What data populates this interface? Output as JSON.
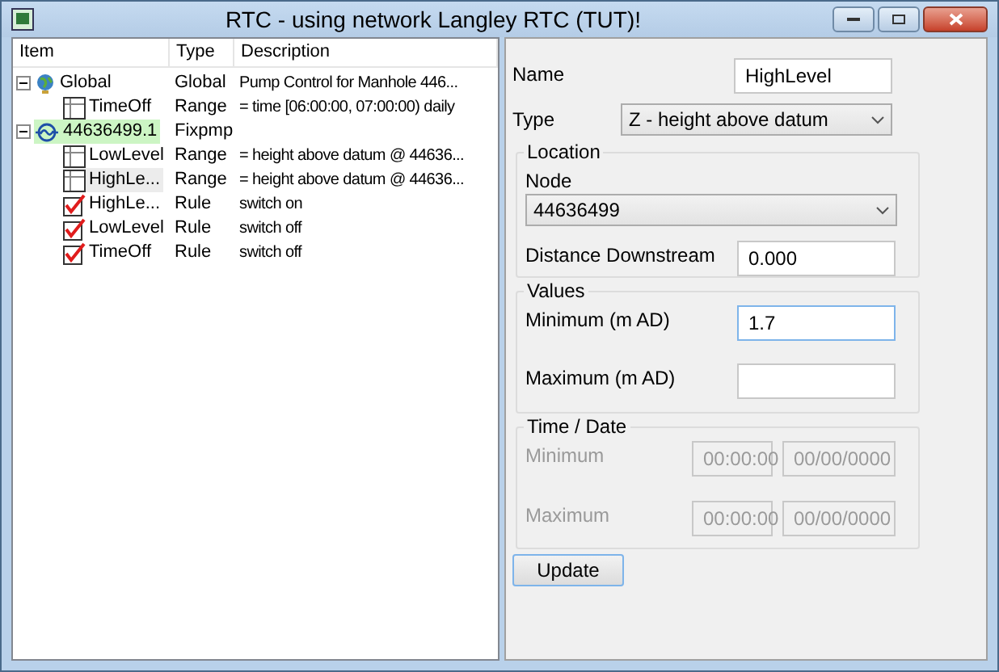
{
  "window": {
    "title": "RTC -  using network Langley RTC (TUT)!"
  },
  "tree": {
    "columns": [
      "Item",
      "Type",
      "Description"
    ],
    "items": [
      {
        "label": "Global",
        "kind": "globe",
        "type": "Global",
        "description": "Pump Control for Manhole 446...",
        "selected": false,
        "hovered": false,
        "expanded": true,
        "children": [
          {
            "label": "TimeOff",
            "kind": "range",
            "type": "Range",
            "description": "= time [06:00:00, 07:00:00) daily",
            "selected": false,
            "hovered": false
          }
        ]
      },
      {
        "label": "44636499.1",
        "kind": "pump",
        "type": "Fixpmp",
        "selected": true,
        "hovered": false,
        "expanded": true,
        "children": [
          {
            "label": "LowLevel",
            "kind": "range",
            "type": "Range",
            "description": "= height above datum @ 44636...",
            "selected": false,
            "hovered": false
          },
          {
            "label": "HighLe...",
            "kind": "range",
            "type": "Range",
            "description": "= height above datum @ 44636...",
            "selected": false,
            "hovered": true
          },
          {
            "label": "HighLe...",
            "kind": "rule",
            "type": "Rule",
            "description": "switch on",
            "selected": false,
            "hovered": false
          },
          {
            "label": "LowLevel",
            "kind": "rule",
            "type": "Rule",
            "description": "switch off",
            "selected": false,
            "hovered": false
          },
          {
            "label": "TimeOff",
            "kind": "rule",
            "type": "Rule",
            "description": "switch off",
            "selected": false,
            "hovered": false
          }
        ]
      }
    ]
  },
  "form": {
    "name_label": "Name",
    "name_value": "HighLevel",
    "type_label": "Type",
    "type_value": "Z - height above datum",
    "location": {
      "title": "Location",
      "node_label": "Node",
      "node_value": "44636499",
      "distance_label": "Distance Downstream",
      "distance_value": "0.000"
    },
    "values": {
      "title": "Values",
      "minimum_label": "Minimum (m AD)",
      "minimum_value": "1.7",
      "maximum_label": "Maximum (m AD)"
    },
    "time_date": {
      "title": "Time / Date",
      "disabled": true,
      "rows": [
        {
          "label": "Minimum",
          "time": "00:00:00",
          "date": "00/00/0000"
        },
        {
          "label": "Maximum",
          "time": "00:00:00",
          "date": "00/00/0000"
        }
      ]
    },
    "update_button": "Update"
  }
}
